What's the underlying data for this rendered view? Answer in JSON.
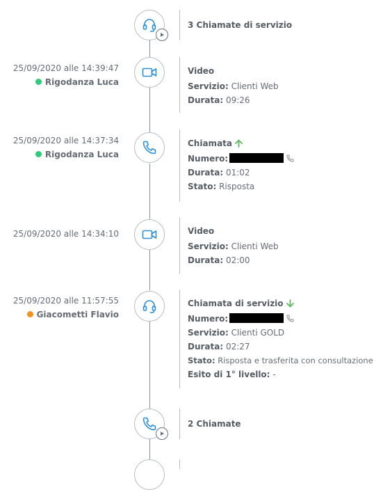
{
  "colors": {
    "icon_blue": "#2a8fd6",
    "online_green": "#2ecb7a",
    "away_orange": "#f0931f",
    "arrow_green": "#5cb85c"
  },
  "timeline": {
    "group_top": {
      "title": "3 Chiamate di servizio",
      "icon": "headset-icon"
    },
    "entries": [
      {
        "timestamp": "25/09/2020 alle 14:39:47",
        "agent": "Rigodanza Luca",
        "status": "online",
        "title": "Video",
        "icon": "video-camera-icon",
        "servizio_label": "Servizio:",
        "servizio": "Clienti Web",
        "durata_label": "Durata:",
        "durata": "09:26"
      },
      {
        "timestamp": "25/09/2020 alle 14:37:34",
        "agent": "Rigodanza Luca",
        "status": "online",
        "title": "Chiamata",
        "icon": "phone-icon",
        "direction": "outgoing",
        "numero_label": "Numero:",
        "durata_label": "Durata:",
        "durata": "01:02",
        "stato_label": "Stato:",
        "stato": "Risposta"
      },
      {
        "timestamp": "25/09/2020 alle 14:34:10",
        "title": "Video",
        "icon": "video-camera-icon",
        "servizio_label": "Servizio:",
        "servizio": "Clienti Web",
        "durata_label": "Durata:",
        "durata": "02:00"
      },
      {
        "timestamp": "25/09/2020 alle 11:57:55",
        "agent": "Giacometti Flavio",
        "status": "away",
        "title": "Chiamata di servizio",
        "icon": "headset-icon",
        "direction": "incoming",
        "numero_label": "Numero:",
        "servizio_label": "Servizio:",
        "servizio": "Clienti GOLD",
        "durata_label": "Durata:",
        "durata": "02:27",
        "stato_label": "Stato:",
        "stato": "Risposta e trasferita con consultazione",
        "esito_label": "Esito di 1° livello:",
        "esito": "-"
      }
    ],
    "group_bottom": {
      "title": "2 Chiamate",
      "icon": "phone-icon"
    }
  }
}
